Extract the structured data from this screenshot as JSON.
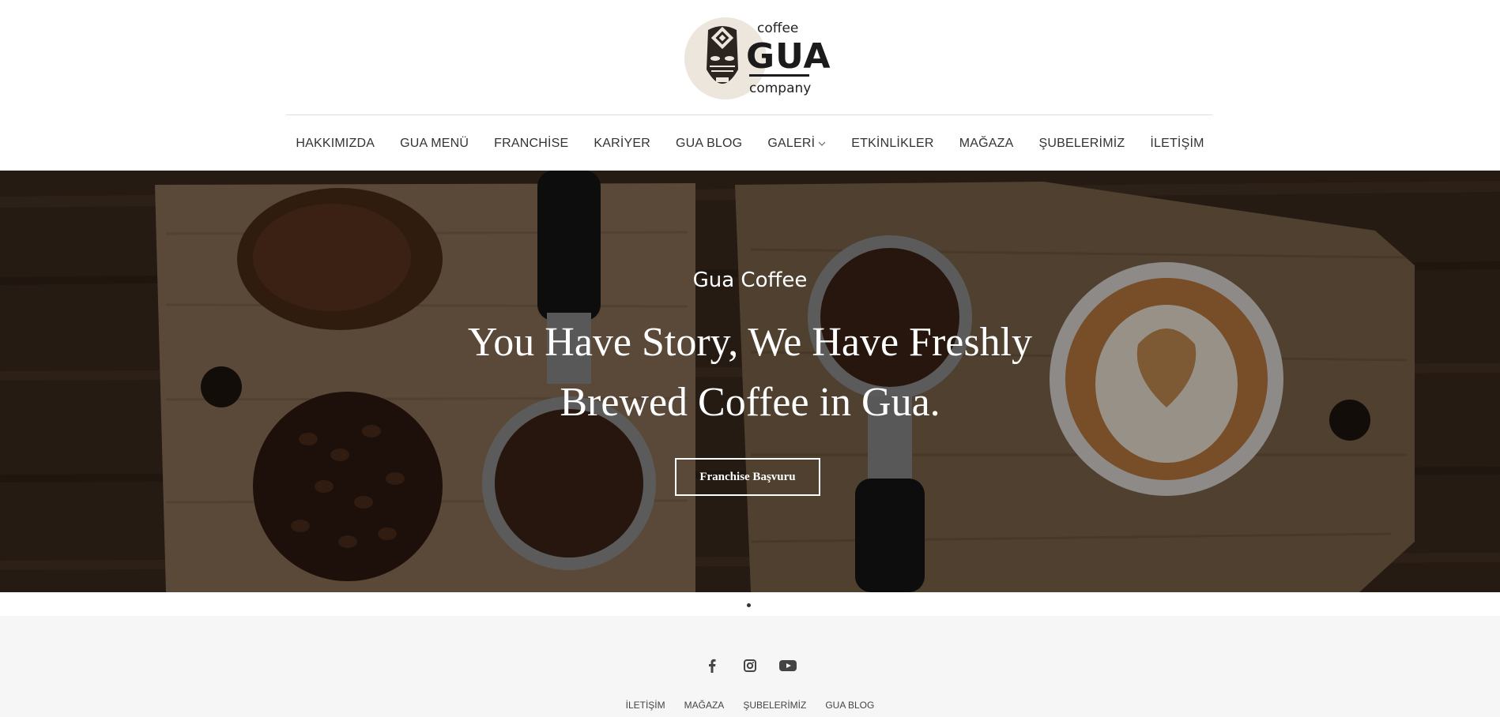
{
  "logo": {
    "top_word": "coffee",
    "main_word": "GUA",
    "bottom_word": "company"
  },
  "nav": {
    "items": [
      {
        "label": "HAKKIMIZDA"
      },
      {
        "label": "GUA MENÜ"
      },
      {
        "label": "FRANCHİSE"
      },
      {
        "label": "KARİYER"
      },
      {
        "label": "GUA BLOG"
      },
      {
        "label": "GALERİ",
        "has_dropdown": true
      },
      {
        "label": "ETKİNLİKLER"
      },
      {
        "label": "MAĞAZA"
      },
      {
        "label": "ŞUBELERİMİZ"
      },
      {
        "label": "İLETİŞİM"
      }
    ]
  },
  "hero": {
    "eyebrow": "Gua Coffee",
    "title_line1": "You Have Story, We Have Freshly",
    "title_line2": "Brewed Coffee in Gua.",
    "button_label": "Franchise Başvuru"
  },
  "slider": {
    "slide_count": 1,
    "active_index": 0
  },
  "footer": {
    "social_icons": [
      "facebook-icon",
      "instagram-icon",
      "youtube-icon"
    ],
    "links": [
      {
        "label": "İLETİŞİM"
      },
      {
        "label": "MAĞAZA"
      },
      {
        "label": "ŞUBELERİMİZ"
      },
      {
        "label": "GUA BLOG"
      }
    ]
  },
  "colors": {
    "accent": "#333333",
    "footer_bg": "#f6f6f6",
    "hero_text": "#ffffff"
  }
}
